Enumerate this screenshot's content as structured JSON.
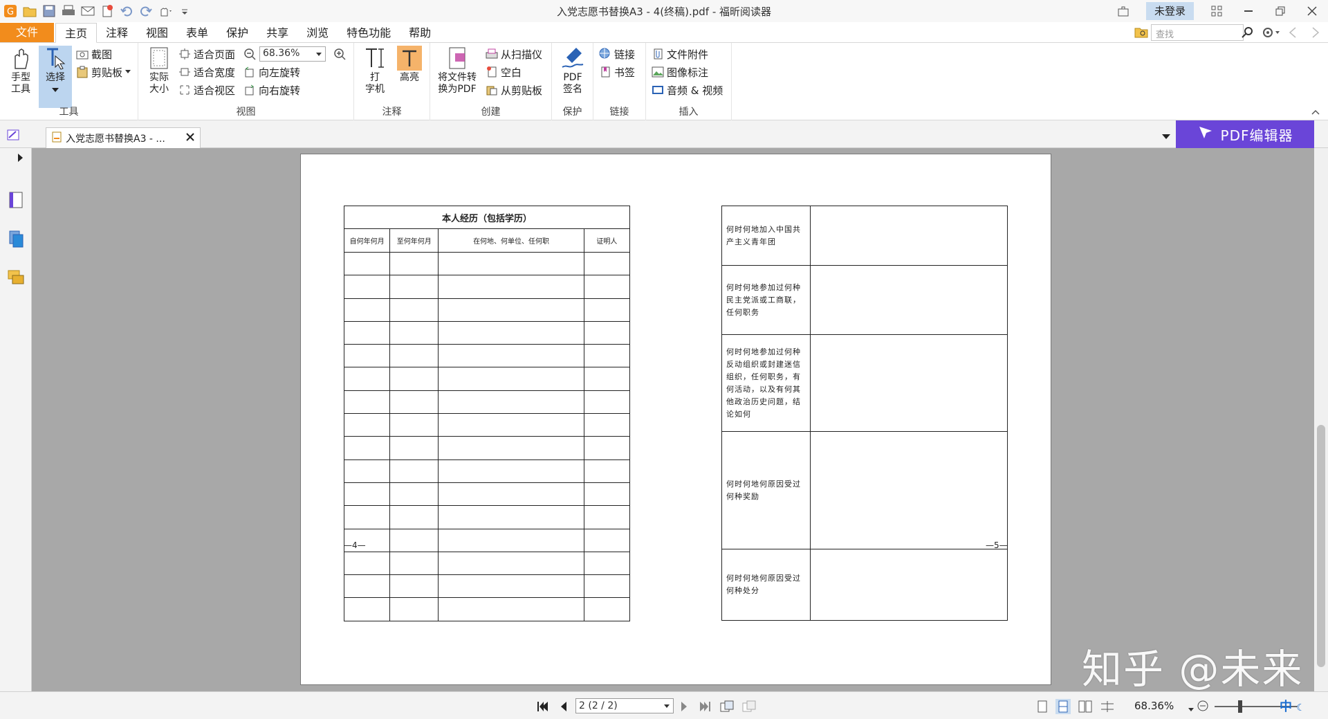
{
  "window": {
    "title": "入党志愿书替换A3 - 4(终稿).pdf - 福昕阅读器",
    "login": "未登录"
  },
  "menu": {
    "file": "文件",
    "tabs": [
      "主页",
      "注释",
      "视图",
      "表单",
      "保护",
      "共享",
      "浏览",
      "特色功能",
      "帮助"
    ],
    "active_tab": "主页",
    "search_placeholder": "查找"
  },
  "ribbon": {
    "tools": {
      "hand": "手型\n工具",
      "select": "选择",
      "snapshot": "截图",
      "clipboard": "剪贴板",
      "label": "工具"
    },
    "view": {
      "actual_size": "实际\n大小",
      "fit_page": "适合页面",
      "fit_width": "适合宽度",
      "fit_visible": "适合视区",
      "zoom": "68.36%",
      "rotate_left": "向左旋转",
      "rotate_right": "向右旋转",
      "label": "视图"
    },
    "comment": {
      "typewriter": "打\n字机",
      "highlight": "高亮",
      "label": "注释"
    },
    "create": {
      "convert": "将文件转\n换为PDF",
      "from_scanner": "从扫描仪",
      "blank": "空白",
      "from_clipboard": "从剪贴板",
      "label": "创建"
    },
    "protect": {
      "sign": "PDF\n签名",
      "label": "保护"
    },
    "links": {
      "link": "链接",
      "bookmark": "书签",
      "label": "链接"
    },
    "insert": {
      "attachment": "文件附件",
      "image": "图像标注",
      "av": "音频 & 视频",
      "label": "插入"
    }
  },
  "doc_tab": {
    "title": "入党志愿书替换A3 - ..."
  },
  "editor_button": "PDF编辑器",
  "document": {
    "left_table": {
      "title": "本人经历（包括学历）",
      "headers": [
        "自何年何月",
        "至何年何月",
        "在何地、何单位、任何职",
        "证明人"
      ],
      "empty_rows": 16,
      "page_number": "—4—"
    },
    "right_table": {
      "rows": [
        "何时何地加入中国共产主义青年团",
        "何时何地参加过何种民主党派或工商联，任何职务",
        "何时何地参加过何种反动组织或封建迷信组织，任何职务，有何活动，以及有何其他政治历史问题，结论如何",
        "何时何地何原因受过何种奖励",
        "何时何地何原因受过何种处分"
      ],
      "page_number": "—5—"
    }
  },
  "status": {
    "page": "2 (2 / 2)",
    "zoom": "68.36%",
    "ime": "中"
  },
  "watermark": "知乎 @未来",
  "colors": {
    "file_tab": "#f28c1c",
    "editor_btn": "#6a45d8",
    "canvas": "#a8a8a8"
  }
}
